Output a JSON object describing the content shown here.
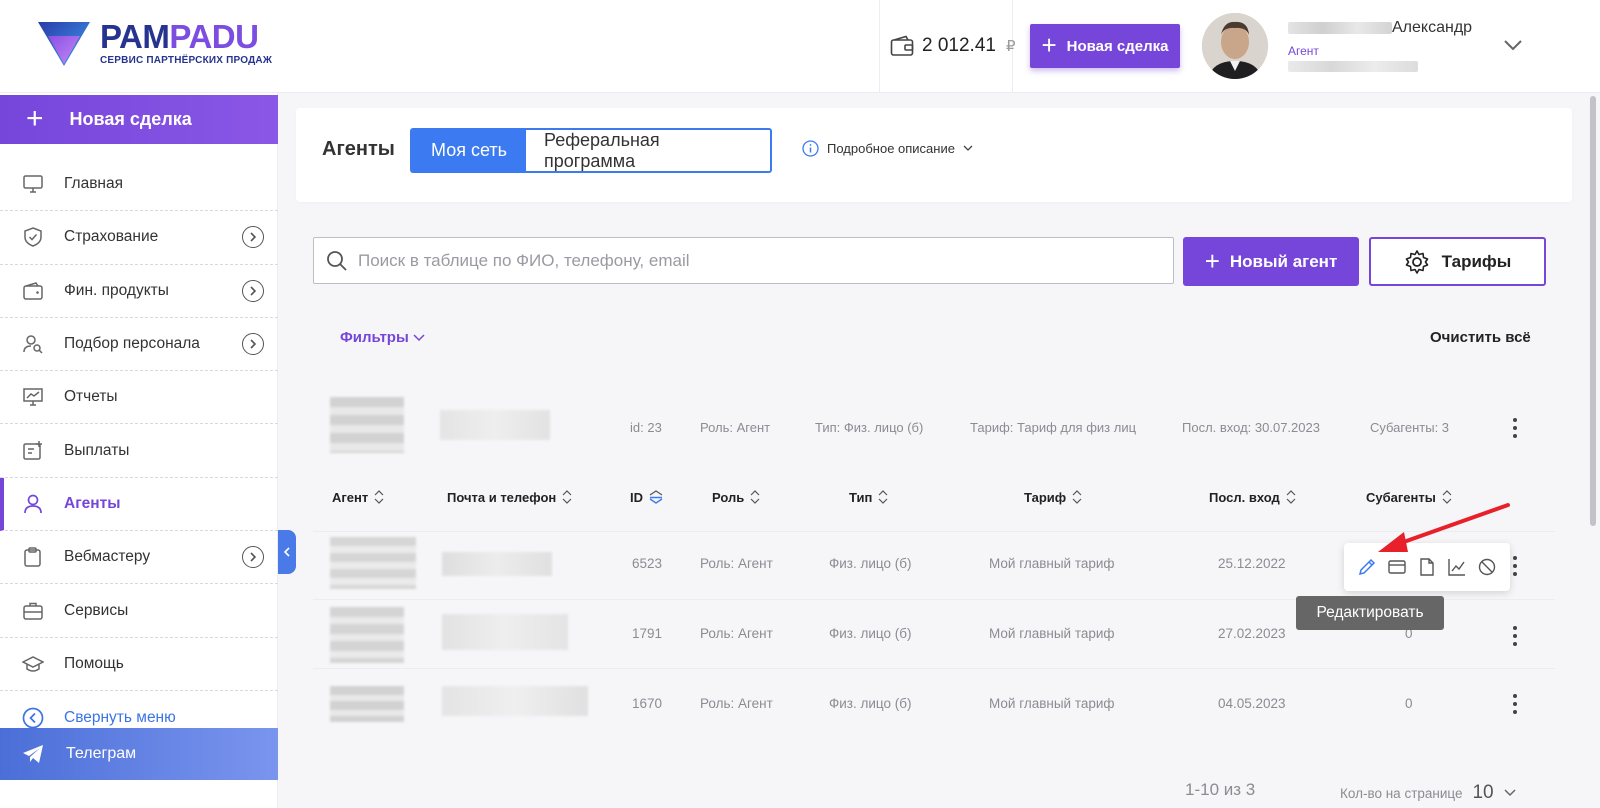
{
  "header": {
    "logo_word_a": "PAM",
    "logo_word_b": "PADU",
    "logo_sub": "СЕРВИС ПАРТНЁРСКИХ ПРОДАЖ",
    "balance": "2 012.41",
    "currency": "₽",
    "new_deal_label": "Новая сделка",
    "user_name": "Александр",
    "user_role": "Агент"
  },
  "sidebar": {
    "new_deal_label": "Новая сделка",
    "items": [
      {
        "label": "Главная"
      },
      {
        "label": "Страхование"
      },
      {
        "label": "Фин. продукты"
      },
      {
        "label": "Подбор персонала"
      },
      {
        "label": "Отчеты"
      },
      {
        "label": "Выплаты"
      },
      {
        "label": "Агенты"
      },
      {
        "label": "Вебмастеру"
      },
      {
        "label": "Сервисы"
      },
      {
        "label": "Помощь"
      }
    ],
    "collapse_label": "Свернуть меню",
    "telegram_label": "Телеграм"
  },
  "page": {
    "title": "Агенты",
    "tabs": [
      "Моя сеть",
      "Реферальная программа"
    ],
    "description_label": "Подробное описание",
    "search_placeholder": "Поиск в таблице по ФИО, телефону, email",
    "new_agent_label": "Новый агент",
    "tariffs_label": "Тарифы",
    "filters_label": "Фильтры",
    "clear_all_label": "Очистить всё"
  },
  "summary": {
    "id": "id: 23",
    "role": "Роль: Агент",
    "type": "Тип: Физ. лицо (б)",
    "tariff": "Тариф: Тариф для физ лиц",
    "last_login": "Посл. вход: 30.07.2023",
    "subagents": "Субагенты: 3"
  },
  "table": {
    "columns": [
      "Агент",
      "Почта и телефон",
      "ID",
      "Роль",
      "Тип",
      "Тариф",
      "Посл. вход",
      "Субагенты"
    ],
    "rows": [
      {
        "id": "6523",
        "role": "Роль: Агент",
        "type": "Физ. лицо (б)",
        "tariff": "Мой главный тариф",
        "last": "25.12.2022",
        "sub": ""
      },
      {
        "id": "1791",
        "role": "Роль: Агент",
        "type": "Физ. лицо (б)",
        "tariff": "Мой главный тариф",
        "last": "27.02.2023",
        "sub": "0"
      },
      {
        "id": "1670",
        "role": "Роль: Агент",
        "type": "Физ. лицо (б)",
        "tariff": "Мой главный тариф",
        "last": "04.05.2023",
        "sub": "0"
      }
    ]
  },
  "tooltip": "Редактировать",
  "pagination": {
    "range": "1-10 из 3",
    "per_page_label": "Кол-во на странице",
    "per_page_value": "10"
  },
  "colors": {
    "accent": "#7646db",
    "blue": "#3b7af0",
    "annotation_red": "#e8202a"
  }
}
